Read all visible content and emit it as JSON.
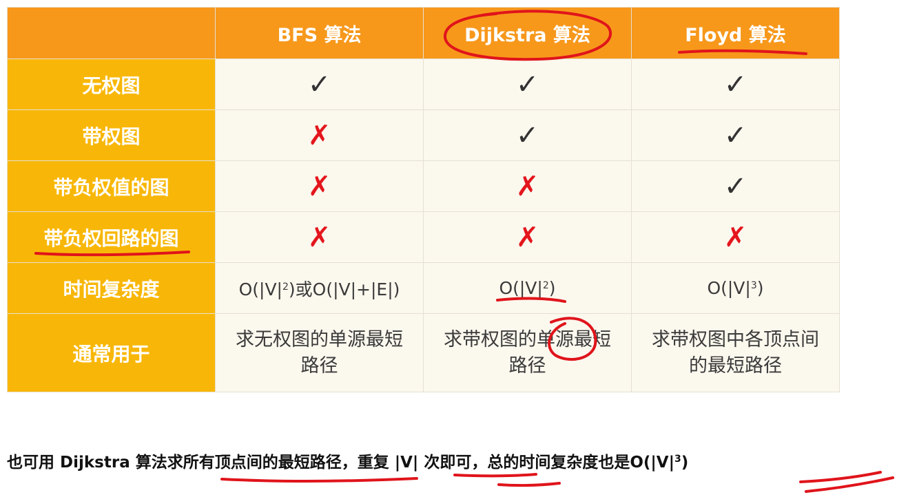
{
  "table": {
    "columns": [
      "BFS 算法",
      "Dijkstra 算法",
      "Floyd 算法"
    ],
    "rows": [
      {
        "label": "无权图",
        "values": [
          "✓",
          "✓",
          "✓"
        ]
      },
      {
        "label": "带权图",
        "values": [
          "✗",
          "✓",
          "✓"
        ]
      },
      {
        "label": "带负权值的图",
        "values": [
          "✗",
          "✗",
          "✓"
        ]
      },
      {
        "label": "带负权回路的图",
        "values": [
          "✗",
          "✗",
          "✗"
        ]
      }
    ],
    "complexity": {
      "label": "时间复杂度",
      "bfs": {
        "a": "O(|V|",
        "sup1": "2",
        "b": ")或O(|V|+|E|)"
      },
      "dijkstra": {
        "a": "O(|V|",
        "sup": "2",
        "b": ")"
      },
      "floyd": {
        "a": "O(|V|",
        "sup": "3",
        "b": ")"
      }
    },
    "usage": {
      "label": "通常用于",
      "values": [
        "求无权图的单源最短路径",
        "求带权图的单源最短路径",
        "求带权图中各顶点间的最短路径"
      ]
    }
  },
  "note": {
    "part1": "也可用 Dijkstra 算法求所有顶点间的最短路径，重复 |V| 次即可，总的时间复杂度也是O(|V|",
    "sup": "3",
    "part2": ")"
  },
  "colors": {
    "header_bg": "#f7981b",
    "rowhead_bg": "#f8b708",
    "cell_bg": "#fbf8ee",
    "cross": "#e4161d",
    "annotation_ink": "#e0141b"
  }
}
